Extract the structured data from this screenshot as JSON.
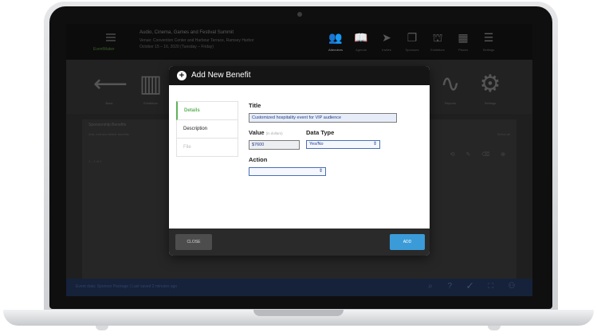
{
  "app": {
    "brand": "EventMaker",
    "event_title": "Audio, Cinema, Games and Festival Summit",
    "event_subtitle": "Venue: Convention Center and Harbour Terrace, Ramsey Harbor",
    "event_date": "October 15 – 16, 2020 (Tuesday – Friday)"
  },
  "top_nav": [
    {
      "icon": "people-icon",
      "glyph": "👥",
      "label": "Attendees"
    },
    {
      "icon": "book-icon",
      "glyph": "📖",
      "label": "Agenda"
    },
    {
      "icon": "send-icon",
      "glyph": "➤",
      "label": "Invites"
    },
    {
      "icon": "copy-icon",
      "glyph": "❐",
      "label": "Sponsors"
    },
    {
      "icon": "org-icon",
      "glyph": "⛫",
      "label": "Exhibitors"
    },
    {
      "icon": "calendar-icon",
      "glyph": "▦",
      "label": "Places"
    },
    {
      "icon": "list-icon",
      "glyph": "☰",
      "label": "Settings"
    }
  ],
  "toolbar": [
    {
      "icon": "back-arrow-icon",
      "glyph": "⟵",
      "label": "Back"
    },
    {
      "icon": "buildings-icon",
      "glyph": "▥",
      "label": "Exhibitors"
    },
    {
      "icon": "chart-icon",
      "glyph": "∿",
      "label": "Reports"
    },
    {
      "icon": "gear-icon",
      "glyph": "⚙",
      "label": "Settings"
    }
  ],
  "section": {
    "heading": "Sponsorship Benefits",
    "subheading": "Add, edit and delete benefits",
    "subheading_right": "Select all",
    "row_text": "1 – 1 of 1",
    "row_actions": "⟲ ✎ ⌫ ⊕"
  },
  "status_bar": {
    "text": "Event data: Sponsor Package | Last saved 2 minutes ago",
    "icons": "⌕ ? ✓ ⛶ ⚇"
  },
  "modal": {
    "header_icon": "+",
    "title": "Add New Benefit",
    "tabs": [
      {
        "label": "Details",
        "state": "active"
      },
      {
        "label": "Description",
        "state": "normal"
      },
      {
        "label": "File",
        "state": "disabled"
      }
    ],
    "title_label": "Title",
    "title_value": "Customized hospitality event for VIP audience",
    "value_label": "Value",
    "value_hint": "(in dollars)",
    "value_value": "$7600",
    "data_type_label": "Data Type",
    "data_type_value": "Yes/No",
    "action_label": "Action",
    "action_value": "",
    "close_label": "CLOSE",
    "add_label": "ADD"
  },
  "colors": {
    "accent_green": "#5fb25a",
    "add_button_blue": "#3a9bd8",
    "select_border": "#4a6fb5"
  }
}
